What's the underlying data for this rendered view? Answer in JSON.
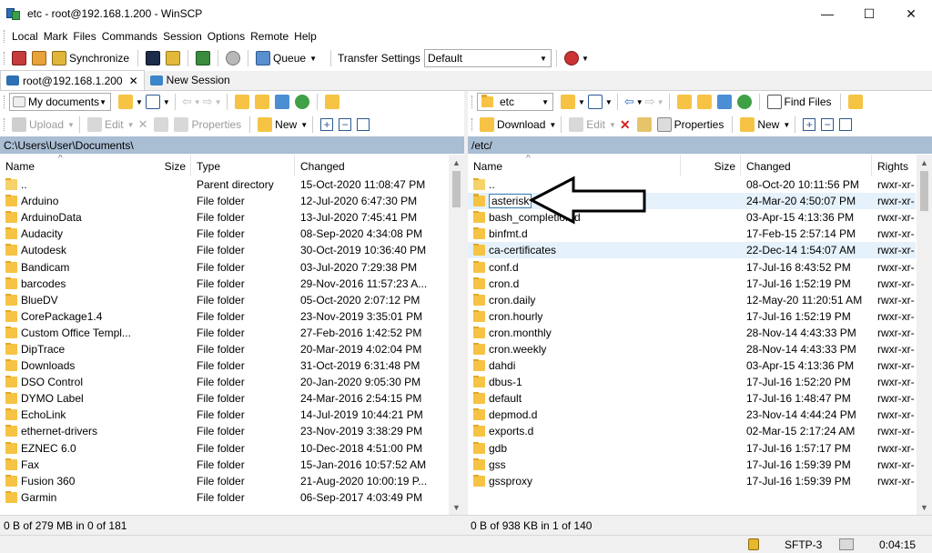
{
  "window": {
    "title": "etc - root@192.168.1.200 - WinSCP",
    "min": "—",
    "max": "☐",
    "close": "✕"
  },
  "menu": [
    "Local",
    "Mark",
    "Files",
    "Commands",
    "Session",
    "Options",
    "Remote",
    "Help"
  ],
  "toolbar": {
    "synchronize": "Synchronize",
    "queue": "Queue",
    "transfer_settings": "Transfer Settings",
    "transfer_value": "Default"
  },
  "tabs": [
    {
      "label": "root@192.168.1.200",
      "close": "✕"
    },
    {
      "label": "New Session"
    }
  ],
  "left": {
    "location": "My documents",
    "actions": {
      "upload": "Upload",
      "edit": "Edit",
      "properties": "Properties",
      "new": "New"
    },
    "path": "C:\\Users\\User\\Documents\\",
    "columns": {
      "name": "Name",
      "size": "Size",
      "type": "Type",
      "changed": "Changed"
    },
    "rows": [
      {
        "name": "..",
        "size": "",
        "type": "Parent directory",
        "changed": "15-Oct-2020 11:08:47 PM",
        "up": true
      },
      {
        "name": "Arduino",
        "size": "",
        "type": "File folder",
        "changed": "12-Jul-2020 6:47:30 PM"
      },
      {
        "name": "ArduinoData",
        "size": "",
        "type": "File folder",
        "changed": "13-Jul-2020 7:45:41 PM"
      },
      {
        "name": "Audacity",
        "size": "",
        "type": "File folder",
        "changed": "08-Sep-2020 4:34:08 PM"
      },
      {
        "name": "Autodesk",
        "size": "",
        "type": "File folder",
        "changed": "30-Oct-2019 10:36:40 PM"
      },
      {
        "name": "Bandicam",
        "size": "",
        "type": "File folder",
        "changed": "03-Jul-2020 7:29:38 PM"
      },
      {
        "name": "barcodes",
        "size": "",
        "type": "File folder",
        "changed": "29-Nov-2016 11:57:23 A..."
      },
      {
        "name": "BlueDV",
        "size": "",
        "type": "File folder",
        "changed": "05-Oct-2020 2:07:12 PM"
      },
      {
        "name": "CorePackage1.4",
        "size": "",
        "type": "File folder",
        "changed": "23-Nov-2019 3:35:01 PM"
      },
      {
        "name": "Custom Office Templ...",
        "size": "",
        "type": "File folder",
        "changed": "27-Feb-2016 1:42:52 PM"
      },
      {
        "name": "DipTrace",
        "size": "",
        "type": "File folder",
        "changed": "20-Mar-2019 4:02:04 PM"
      },
      {
        "name": "Downloads",
        "size": "",
        "type": "File folder",
        "changed": "31-Oct-2019 6:31:48 PM"
      },
      {
        "name": "DSO Control",
        "size": "",
        "type": "File folder",
        "changed": "20-Jan-2020 9:05:30 PM"
      },
      {
        "name": "DYMO Label",
        "size": "",
        "type": "File folder",
        "changed": "24-Mar-2016 2:54:15 PM"
      },
      {
        "name": "EchoLink",
        "size": "",
        "type": "File folder",
        "changed": "14-Jul-2019 10:44:21 PM"
      },
      {
        "name": "ethernet-drivers",
        "size": "",
        "type": "File folder",
        "changed": "23-Nov-2019 3:38:29 PM"
      },
      {
        "name": "EZNEC 6.0",
        "size": "",
        "type": "File folder",
        "changed": "10-Dec-2018 4:51:00 PM"
      },
      {
        "name": "Fax",
        "size": "",
        "type": "File folder",
        "changed": "15-Jan-2016 10:57:52 AM"
      },
      {
        "name": "Fusion 360",
        "size": "",
        "type": "File folder",
        "changed": "21-Aug-2020 10:00:19 P..."
      },
      {
        "name": "Garmin",
        "size": "",
        "type": "File folder",
        "changed": "06-Sep-2017 4:03:49 PM"
      }
    ],
    "status": "0 B of 279 MB in 0 of 181"
  },
  "right": {
    "location": "etc",
    "find_files": "Find Files",
    "actions": {
      "download": "Download",
      "edit": "Edit",
      "properties": "Properties",
      "new": "New"
    },
    "path": "/etc/",
    "columns": {
      "name": "Name",
      "size": "Size",
      "changed": "Changed",
      "rights": "Rights"
    },
    "rows": [
      {
        "name": "..",
        "size": "",
        "changed": "08-Oct-20 10:11:56 PM",
        "rights": "rwxr-xr-",
        "up": true
      },
      {
        "name": "asterisk",
        "size": "",
        "changed": "24-Mar-20 4:50:07 PM",
        "rights": "rwxr-xr-",
        "rename": true
      },
      {
        "name": "bash_completion.d",
        "size": "",
        "changed": "03-Apr-15 4:13:36 PM",
        "rights": "rwxr-xr-"
      },
      {
        "name": "binfmt.d",
        "size": "",
        "changed": "17-Feb-15 2:57:14 PM",
        "rights": "rwxr-xr-"
      },
      {
        "name": "ca-certificates",
        "size": "",
        "changed": "22-Dec-14 1:54:07 AM",
        "rights": "rwxr-xr-",
        "sel": true
      },
      {
        "name": "conf.d",
        "size": "",
        "changed": "17-Jul-16 8:43:52 PM",
        "rights": "rwxr-xr-"
      },
      {
        "name": "cron.d",
        "size": "",
        "changed": "17-Jul-16 1:52:19 PM",
        "rights": "rwxr-xr-"
      },
      {
        "name": "cron.daily",
        "size": "",
        "changed": "12-May-20 11:20:51 AM",
        "rights": "rwxr-xr-"
      },
      {
        "name": "cron.hourly",
        "size": "",
        "changed": "17-Jul-16 1:52:19 PM",
        "rights": "rwxr-xr-"
      },
      {
        "name": "cron.monthly",
        "size": "",
        "changed": "28-Nov-14 4:43:33 PM",
        "rights": "rwxr-xr-"
      },
      {
        "name": "cron.weekly",
        "size": "",
        "changed": "28-Nov-14 4:43:33 PM",
        "rights": "rwxr-xr-"
      },
      {
        "name": "dahdi",
        "size": "",
        "changed": "03-Apr-15 4:13:36 PM",
        "rights": "rwxr-xr-"
      },
      {
        "name": "dbus-1",
        "size": "",
        "changed": "17-Jul-16 1:52:20 PM",
        "rights": "rwxr-xr-"
      },
      {
        "name": "default",
        "size": "",
        "changed": "17-Jul-16 1:48:47 PM",
        "rights": "rwxr-xr-"
      },
      {
        "name": "depmod.d",
        "size": "",
        "changed": "23-Nov-14 4:44:24 PM",
        "rights": "rwxr-xr-"
      },
      {
        "name": "exports.d",
        "size": "",
        "changed": "02-Mar-15 2:17:24 AM",
        "rights": "rwxr-xr-"
      },
      {
        "name": "gdb",
        "size": "",
        "changed": "17-Jul-16 1:57:17 PM",
        "rights": "rwxr-xr-"
      },
      {
        "name": "gss",
        "size": "",
        "changed": "17-Jul-16 1:59:39 PM",
        "rights": "rwxr-xr-"
      },
      {
        "name": "gssproxy",
        "size": "",
        "changed": "17-Jul-16 1:59:39 PM",
        "rights": "rwxr-xr-"
      }
    ],
    "status": "0 B of 938 KB in 1 of 140"
  },
  "bottom": {
    "protocol": "SFTP-3",
    "time": "0:04:15"
  },
  "icons": {
    "arrow_back": "⇦",
    "arrow_fwd": "⇨",
    "dropdown": "▼",
    "plus": "+",
    "minus": "−",
    "close": "✕",
    "up": "▲",
    "down": "▼",
    "caret": "^"
  },
  "colors": {
    "path_bar": "#a9bdd3",
    "folder": "#f6c344",
    "selection": "#e5f1fb",
    "rename_border": "#3c7fb1"
  }
}
